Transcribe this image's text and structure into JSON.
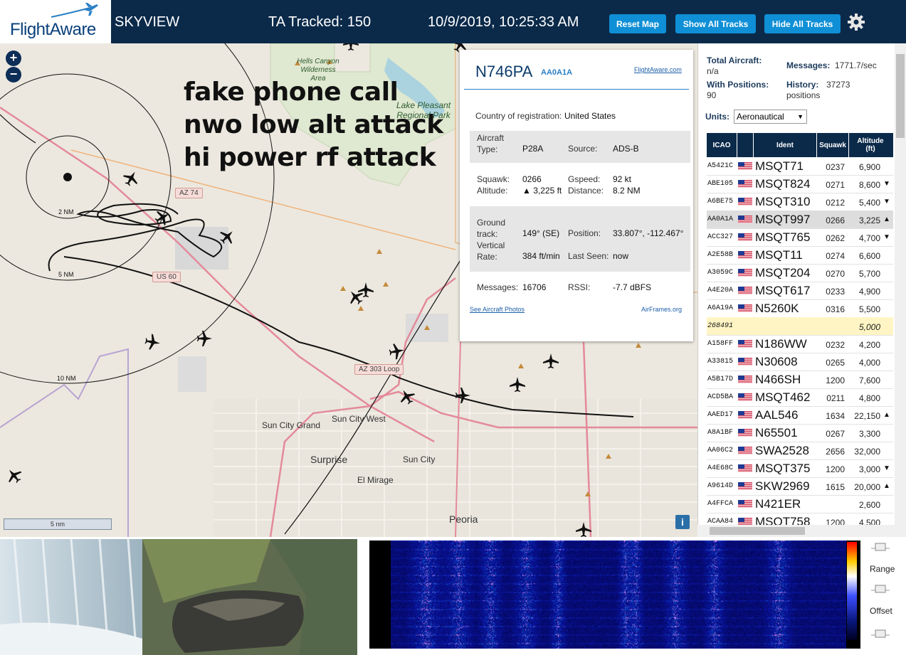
{
  "header": {
    "logo_text": "FlightAware",
    "app_name": "SKYVIEW",
    "tracked": "TA Tracked: 150",
    "datetime": "10/9/2019, 10:25:33 AM",
    "buttons": {
      "reset": "Reset Map",
      "show": "Show All Tracks",
      "hide": "Hide All Tracks"
    }
  },
  "map": {
    "annotations": [
      "fake phone call",
      "nwo low alt attack",
      "hi power rf attack"
    ],
    "roads": {
      "az74": "AZ 74",
      "us60": "US 60",
      "az303": "AZ 303 Loop"
    },
    "places": {
      "hells_canyon": "Hells Canyon Wilderness Area",
      "lake_pleasant": "Lake Pleasant Regional Park",
      "sun_city_grand": "Sun City Grand",
      "sun_city_west": "Sun City West",
      "surprise": "Surprise",
      "sun_city": "Sun City",
      "el_mirage": "El Mirage",
      "peoria": "Peoria"
    },
    "rings": [
      "2 NM",
      "5 NM",
      "10 NM"
    ],
    "scale": "5 nm",
    "zoom_in": "+",
    "zoom_out": "−",
    "info": "i"
  },
  "popup": {
    "registration": "N746PA",
    "hex": "AA0A1A",
    "fa_link": "FlightAware.com",
    "country_label": "Country of registration:",
    "country": "United States",
    "aircraft_type_label": "Aircraft Type:",
    "aircraft_type": "P28A",
    "source_label": "Source:",
    "source": "ADS-B",
    "squawk_label": "Squawk:",
    "squawk": "0266",
    "gspeed_label": "Gspeed:",
    "gspeed": "92 kt",
    "altitude_label": "Altitude:",
    "altitude": "▲ 3,225 ft",
    "distance_label": "Distance:",
    "distance": "8.2 NM",
    "ground_track_label": "Ground track:",
    "ground_track": "149° (SE)",
    "position_label": "Position:",
    "position": "33.807°, -112.467°",
    "vertical_rate_label": "Vertical Rate:",
    "vertical_rate": "384 ft/min",
    "last_seen_label": "Last Seen:",
    "last_seen": "now",
    "messages_label": "Messages:",
    "messages": "16706",
    "rssi_label": "RSSI:",
    "rssi": "-7.7 dBFS",
    "photos_link": "See Aircraft Photos",
    "airframes_link": "AirFrames.org"
  },
  "stats": {
    "total_label": "Total Aircraft:",
    "total": "n/a",
    "messages_label": "Messages:",
    "messages": "1771.7/sec",
    "with_pos_label": "With Positions:",
    "with_pos": "90",
    "history_label": "History:",
    "history": "37273 positions",
    "units_label": "Units:",
    "units": "Aeronautical"
  },
  "table": {
    "headers": [
      "ICAO",
      "Ident",
      "Squawk",
      "Altitude (ft)"
    ],
    "rows": [
      {
        "icao": "A5421C",
        "ident": "MSQT71",
        "squawk": "0237",
        "alt": "6,900",
        "arrow": ""
      },
      {
        "icao": "ABE105",
        "ident": "MSQT824",
        "squawk": "0271",
        "alt": "8,600",
        "arrow": "▼"
      },
      {
        "icao": "A6BE75",
        "ident": "MSQT310",
        "squawk": "0212",
        "alt": "5,400",
        "arrow": "▼"
      },
      {
        "icao": "AA0A1A",
        "ident": "MSQT997",
        "squawk": "0266",
        "alt": "3,225",
        "arrow": "▲"
      },
      {
        "icao": "ACC327",
        "ident": "MSQT765",
        "squawk": "0262",
        "alt": "4,700",
        "arrow": "▼"
      },
      {
        "icao": "A2E58B",
        "ident": "MSQT11",
        "squawk": "0274",
        "alt": "6,600",
        "arrow": ""
      },
      {
        "icao": "A3059C",
        "ident": "MSQT204",
        "squawk": "0270",
        "alt": "5,700",
        "arrow": ""
      },
      {
        "icao": "A4E20A",
        "ident": "MSQT617",
        "squawk": "0233",
        "alt": "4,900",
        "arrow": ""
      },
      {
        "icao": "A6A19A",
        "ident": "N5260K",
        "squawk": "0316",
        "alt": "5,500",
        "arrow": ""
      },
      {
        "icao": "268491",
        "ident": "",
        "squawk": "",
        "alt": "5,000",
        "arrow": ""
      },
      {
        "icao": "A158FF",
        "ident": "N186WW",
        "squawk": "0232",
        "alt": "4,200",
        "arrow": ""
      },
      {
        "icao": "A33815",
        "ident": "N30608",
        "squawk": "0265",
        "alt": "4,000",
        "arrow": ""
      },
      {
        "icao": "A5B17D",
        "ident": "N466SH",
        "squawk": "1200",
        "alt": "7,600",
        "arrow": ""
      },
      {
        "icao": "ACD5BA",
        "ident": "MSQT462",
        "squawk": "0211",
        "alt": "4,800",
        "arrow": ""
      },
      {
        "icao": "AAED17",
        "ident": "AAL546",
        "squawk": "1634",
        "alt": "22,150",
        "arrow": "▲"
      },
      {
        "icao": "A8A1BF",
        "ident": "N65501",
        "squawk": "0267",
        "alt": "3,300",
        "arrow": ""
      },
      {
        "icao": "AA06C2",
        "ident": "SWA2528",
        "squawk": "2656",
        "alt": "32,000",
        "arrow": ""
      },
      {
        "icao": "A4E68C",
        "ident": "MSQT375",
        "squawk": "1200",
        "alt": "3,000",
        "arrow": "▼"
      },
      {
        "icao": "A9614D",
        "ident": "SKW2969",
        "squawk": "1615",
        "alt": "20,000",
        "arrow": "▲"
      },
      {
        "icao": "A4FFCA",
        "ident": "N421ER",
        "squawk": "",
        "alt": "2,600",
        "arrow": ""
      },
      {
        "icao": "ACAA84",
        "ident": "MSQT758",
        "squawk": "1200",
        "alt": "4,500",
        "arrow": ""
      }
    ]
  },
  "waterfall": {
    "range_label": "Range",
    "offset_label": "Offset"
  },
  "colors": {
    "header_bg": "#0b2a4a",
    "button": "#0f8fd6",
    "accent": "#2a7fc4"
  }
}
